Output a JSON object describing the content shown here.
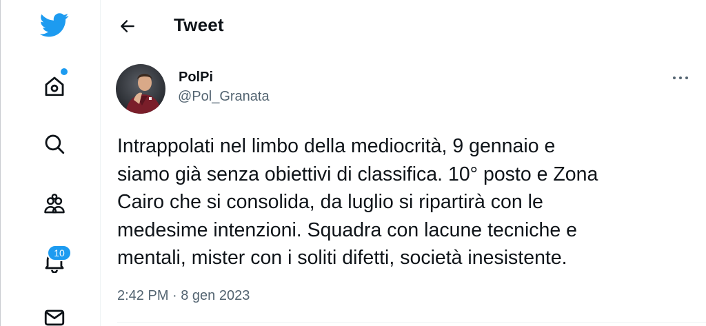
{
  "nav": {
    "logo_icon": "twitter-bird-icon",
    "home_icon": "home-icon",
    "search_icon": "search-icon",
    "communities_icon": "communities-icon",
    "notifications_icon": "bell-icon",
    "notifications_count": "10",
    "messages_icon": "mail-icon",
    "accent_color": "#1d9bf0"
  },
  "header": {
    "back_icon": "arrow-left-icon",
    "title": "Tweet"
  },
  "tweet": {
    "author_name": "PolPi",
    "author_handle": "@Pol_Granata",
    "more_icon": "more-horizontal-icon",
    "text": "Intrappolati nel limbo della mediocrità, 9 gennaio e\nsiamo già senza obiettivi di classifica. 10° posto e Zona\nCairo che si consolida, da luglio si ripartirà con le\nmedesime intenzioni. Squadra con lacune tecniche e\nmentali, mister con i soliti difetti, società inesistente.",
    "timestamp": "2:42 PM · 8 gen 2023"
  }
}
